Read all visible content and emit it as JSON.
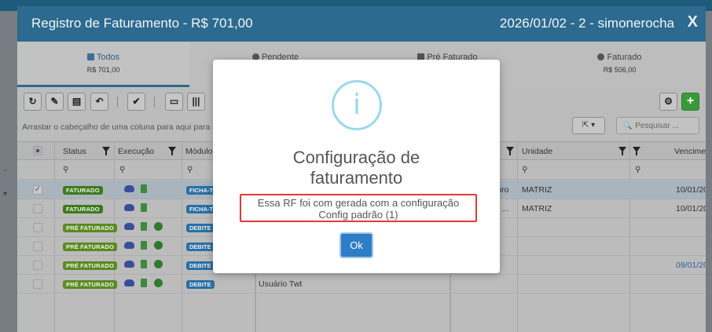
{
  "window": {
    "title": "Registro de Faturamento - R$ 701,00",
    "info": "2026/01/02 - 2 - simonerocha",
    "close_label": "X"
  },
  "tabs": [
    {
      "label": "Todos",
      "amount": "R$ 701,00",
      "icon": "document-icon",
      "active": true
    },
    {
      "label": "Pendente",
      "amount": "",
      "icon": "clock-icon",
      "active": false
    },
    {
      "label": "Pré Faturado",
      "amount": "",
      "icon": "document-icon",
      "active": false
    },
    {
      "label": "Faturado",
      "amount": "R$ 506,00",
      "icon": "check-circle-icon",
      "active": false
    }
  ],
  "toolbar": {
    "refresh": "↻",
    "edit": "✎",
    "doc": "▤",
    "undo": "↶",
    "check": "✔",
    "card": "▭",
    "barcode": "|||",
    "settings": "⚙",
    "add": "+"
  },
  "grid": {
    "grouping_hint": "Arrastar o cabeçalho de uma coluna para aqui para agr",
    "export_label": "⇱ ▾",
    "search_placeholder": "Pesquisar ...",
    "search_icon": "🔍",
    "columns": [
      "Status",
      "Execução",
      "Módulo",
      "Unidade",
      "Vencimer"
    ],
    "rows": [
      {
        "status": "FATURADO",
        "status_type": "fat",
        "module": "FICHA-TE",
        "col4": "eiro",
        "unit": "MATRIZ",
        "due": "10/01/20",
        "due_blue": false,
        "download": false,
        "checked": true,
        "selected": true
      },
      {
        "status": "FATURADO",
        "status_type": "fat",
        "module": "FICHA-TE",
        "col4": "o ...",
        "unit": "MATRIZ",
        "due": "10/01/20",
        "due_blue": false,
        "download": false,
        "checked": false,
        "selected": false
      },
      {
        "status": "PRÉ FATURADO",
        "status_type": "pre",
        "module": "DEBITE",
        "col4": "",
        "unit": "",
        "due": "",
        "due_blue": false,
        "download": true,
        "checked": false,
        "selected": false
      },
      {
        "status": "PRÉ FATURADO",
        "status_type": "pre",
        "module": "DEBITE",
        "col4": "",
        "unit": "",
        "due": "",
        "due_blue": false,
        "download": true,
        "checked": false,
        "selected": false
      },
      {
        "status": "PRÉ FATURADO",
        "status_type": "pre",
        "module": "DEBITE",
        "col4": "",
        "unit": "",
        "due": "09/01/20",
        "due_blue": true,
        "download": true,
        "checked": false,
        "selected": false
      },
      {
        "status": "PRÉ FATURADO",
        "status_type": "pre",
        "module": "DEBITE",
        "col4": "Usuário Twt",
        "unit": "",
        "due": "",
        "due_blue": false,
        "download": true,
        "checked": false,
        "selected": false
      }
    ]
  },
  "modal": {
    "icon": "i",
    "title_line1": "Configuração de",
    "title_line2": "faturamento",
    "message_line1": "Essa RF foi com gerada com a configuração",
    "message_line2": "Config padrão (1)",
    "ok_label": "Ok"
  },
  "colors": {
    "header": "#2d6a8f",
    "accent": "#2d7dc7",
    "info": "#9bd8ec",
    "highlight": "#e03a3a"
  }
}
